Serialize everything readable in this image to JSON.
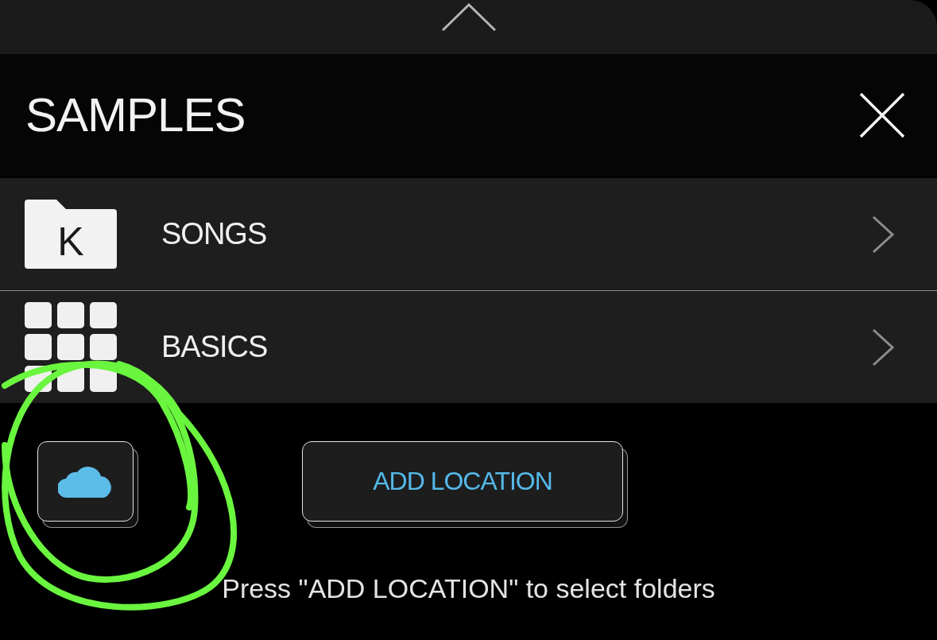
{
  "header": {
    "title": "SAMPLES"
  },
  "items": [
    {
      "kind": "folder",
      "icon_letter": "K",
      "label": "SONGS"
    },
    {
      "kind": "grid",
      "label": "BASICS"
    }
  ],
  "actions": {
    "add_location": "ADD LOCATION"
  },
  "help_text": "Press \"ADD LOCATION\" to select folders"
}
